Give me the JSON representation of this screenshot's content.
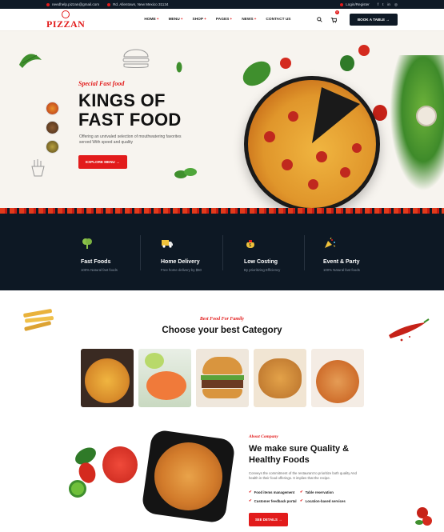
{
  "topbar": {
    "email": "needhelp.pizzan@gmail.com",
    "address": "Rd. Allentown, New Mexico 31134",
    "login": "Login/Register",
    "social": [
      "f",
      "t",
      "in",
      "◎"
    ]
  },
  "header": {
    "logo_text": "PIZZAN",
    "nav": [
      {
        "label": "HOME"
      },
      {
        "label": "MENU"
      },
      {
        "label": "SHOP"
      },
      {
        "label": "PAGES"
      },
      {
        "label": "NEWS"
      },
      {
        "label": "CONTACT US"
      }
    ],
    "cart_count": "0",
    "book_label": "BOOK A TABLE"
  },
  "hero": {
    "kicker": "Special Fast food",
    "title_line1": "KINGS OF",
    "title_line2": "FAST FOOD",
    "description": "Offering an unrivaled selection of mouthwatering favorites served With speed and quality",
    "button": "EXPLORE MENU"
  },
  "features": [
    {
      "title": "Fast Foods",
      "subtitle": "100% Natural fast foods"
    },
    {
      "title": "Home Delivery",
      "subtitle": "Free home delivery by $50"
    },
    {
      "title": "Low Costing",
      "subtitle": "By prioritizing Efficiency"
    },
    {
      "title": "Event & Party",
      "subtitle": "100% Natural fast foods"
    }
  ],
  "category": {
    "kicker": "Best Food For Family",
    "title": "Choose your best Category"
  },
  "about": {
    "kicker": "About Company",
    "title": "We make sure Quality & Healthy Foods",
    "paragraph": "Conveys the commitment of the restaurant to prioritize both quality And health in their food offerings. It implies that the recipe.",
    "checks": [
      "Food items management",
      "Table reservation",
      "Customer feedback portal",
      "Location-based services"
    ],
    "button": "SEE DETAILS"
  },
  "colors": {
    "accent": "#e21b1b",
    "dark": "#0f1a26",
    "cream": "#f7f4ef"
  }
}
